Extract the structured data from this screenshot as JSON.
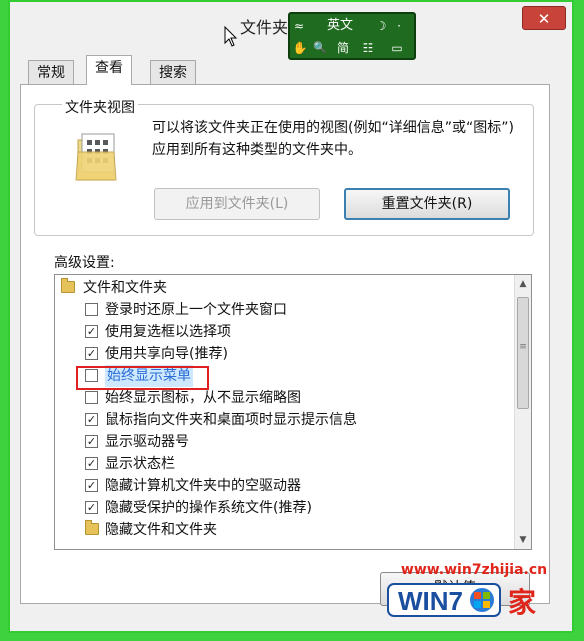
{
  "window": {
    "title": "文件夹",
    "close_glyph": "✕"
  },
  "ime": {
    "mode_label": "英文",
    "toggle_glyph": "≈",
    "moon_glyph": "☽",
    "dots_glyph": "·",
    "hand_glyph": "✋",
    "search_glyph": "🔍",
    "simplified_label": "简",
    "grid_glyph": "☷",
    "keyboard_glyph": "▭"
  },
  "tabs": [
    {
      "label": "常规"
    },
    {
      "label": "查看"
    },
    {
      "label": "搜索"
    }
  ],
  "folder_views": {
    "group_label": "文件夹视图",
    "description": "可以将该文件夹正在使用的视图(例如“详细信息”或“图标”)应用到所有这种类型的文件夹中。",
    "apply_button": "应用到文件夹(L)",
    "reset_button": "重置文件夹(R)"
  },
  "advanced": {
    "label": "高级设置:",
    "items": [
      {
        "type": "folder",
        "text": "文件和文件夹"
      },
      {
        "type": "checkbox",
        "checked": false,
        "text": "登录时还原上一个文件夹窗口"
      },
      {
        "type": "checkbox",
        "checked": true,
        "text": "使用复选框以选择项"
      },
      {
        "type": "checkbox",
        "checked": true,
        "text": "使用共享向导(推荐)"
      },
      {
        "type": "checkbox",
        "checked": false,
        "text": "始终显示菜单",
        "highlighted": true
      },
      {
        "type": "checkbox",
        "checked": false,
        "text": "始终显示图标，从不显示缩略图"
      },
      {
        "type": "checkbox",
        "checked": true,
        "text": "鼠标指向文件夹和桌面项时显示提示信息"
      },
      {
        "type": "checkbox",
        "checked": true,
        "text": "显示驱动器号"
      },
      {
        "type": "checkbox",
        "checked": true,
        "text": "显示状态栏"
      },
      {
        "type": "checkbox",
        "checked": true,
        "text": "隐藏计算机文件夹中的空驱动器"
      },
      {
        "type": "checkbox",
        "checked": true,
        "text": "隐藏受保护的操作系统文件(推荐)"
      },
      {
        "type": "folder",
        "text": "隐藏文件和文件夹"
      }
    ],
    "check_glyph": "✓",
    "scroll_up_glyph": "▲",
    "scroll_down_glyph": "▼",
    "grip_glyph": "≡"
  },
  "restore_button": "默认值",
  "watermark": {
    "url": "www.win7zhijia.cn",
    "brand": "WIN7",
    "suffix": "家"
  }
}
